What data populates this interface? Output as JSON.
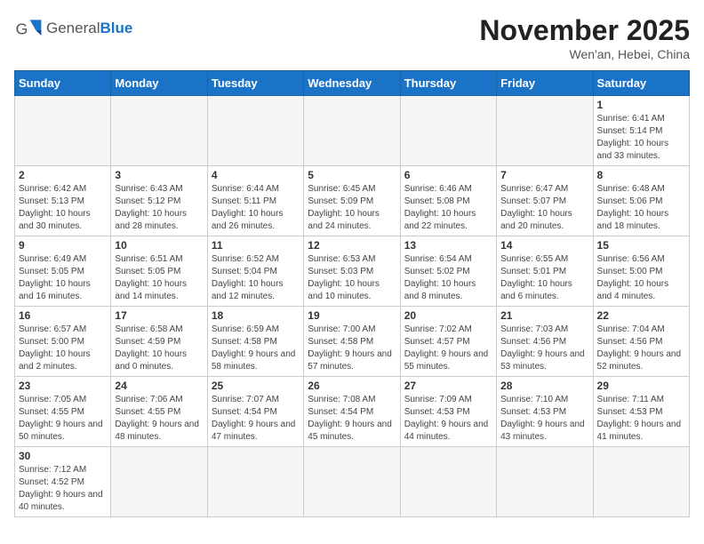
{
  "header": {
    "logo_general": "General",
    "logo_blue": "Blue",
    "month_title": "November 2025",
    "subtitle": "Wen'an, Hebei, China"
  },
  "weekdays": [
    "Sunday",
    "Monday",
    "Tuesday",
    "Wednesday",
    "Thursday",
    "Friday",
    "Saturday"
  ],
  "weeks": [
    [
      {
        "day": "",
        "info": ""
      },
      {
        "day": "",
        "info": ""
      },
      {
        "day": "",
        "info": ""
      },
      {
        "day": "",
        "info": ""
      },
      {
        "day": "",
        "info": ""
      },
      {
        "day": "",
        "info": ""
      },
      {
        "day": "1",
        "info": "Sunrise: 6:41 AM\nSunset: 5:14 PM\nDaylight: 10 hours and 33 minutes."
      }
    ],
    [
      {
        "day": "2",
        "info": "Sunrise: 6:42 AM\nSunset: 5:13 PM\nDaylight: 10 hours and 30 minutes."
      },
      {
        "day": "3",
        "info": "Sunrise: 6:43 AM\nSunset: 5:12 PM\nDaylight: 10 hours and 28 minutes."
      },
      {
        "day": "4",
        "info": "Sunrise: 6:44 AM\nSunset: 5:11 PM\nDaylight: 10 hours and 26 minutes."
      },
      {
        "day": "5",
        "info": "Sunrise: 6:45 AM\nSunset: 5:09 PM\nDaylight: 10 hours and 24 minutes."
      },
      {
        "day": "6",
        "info": "Sunrise: 6:46 AM\nSunset: 5:08 PM\nDaylight: 10 hours and 22 minutes."
      },
      {
        "day": "7",
        "info": "Sunrise: 6:47 AM\nSunset: 5:07 PM\nDaylight: 10 hours and 20 minutes."
      },
      {
        "day": "8",
        "info": "Sunrise: 6:48 AM\nSunset: 5:06 PM\nDaylight: 10 hours and 18 minutes."
      }
    ],
    [
      {
        "day": "9",
        "info": "Sunrise: 6:49 AM\nSunset: 5:05 PM\nDaylight: 10 hours and 16 minutes."
      },
      {
        "day": "10",
        "info": "Sunrise: 6:51 AM\nSunset: 5:05 PM\nDaylight: 10 hours and 14 minutes."
      },
      {
        "day": "11",
        "info": "Sunrise: 6:52 AM\nSunset: 5:04 PM\nDaylight: 10 hours and 12 minutes."
      },
      {
        "day": "12",
        "info": "Sunrise: 6:53 AM\nSunset: 5:03 PM\nDaylight: 10 hours and 10 minutes."
      },
      {
        "day": "13",
        "info": "Sunrise: 6:54 AM\nSunset: 5:02 PM\nDaylight: 10 hours and 8 minutes."
      },
      {
        "day": "14",
        "info": "Sunrise: 6:55 AM\nSunset: 5:01 PM\nDaylight: 10 hours and 6 minutes."
      },
      {
        "day": "15",
        "info": "Sunrise: 6:56 AM\nSunset: 5:00 PM\nDaylight: 10 hours and 4 minutes."
      }
    ],
    [
      {
        "day": "16",
        "info": "Sunrise: 6:57 AM\nSunset: 5:00 PM\nDaylight: 10 hours and 2 minutes."
      },
      {
        "day": "17",
        "info": "Sunrise: 6:58 AM\nSunset: 4:59 PM\nDaylight: 10 hours and 0 minutes."
      },
      {
        "day": "18",
        "info": "Sunrise: 6:59 AM\nSunset: 4:58 PM\nDaylight: 9 hours and 58 minutes."
      },
      {
        "day": "19",
        "info": "Sunrise: 7:00 AM\nSunset: 4:58 PM\nDaylight: 9 hours and 57 minutes."
      },
      {
        "day": "20",
        "info": "Sunrise: 7:02 AM\nSunset: 4:57 PM\nDaylight: 9 hours and 55 minutes."
      },
      {
        "day": "21",
        "info": "Sunrise: 7:03 AM\nSunset: 4:56 PM\nDaylight: 9 hours and 53 minutes."
      },
      {
        "day": "22",
        "info": "Sunrise: 7:04 AM\nSunset: 4:56 PM\nDaylight: 9 hours and 52 minutes."
      }
    ],
    [
      {
        "day": "23",
        "info": "Sunrise: 7:05 AM\nSunset: 4:55 PM\nDaylight: 9 hours and 50 minutes."
      },
      {
        "day": "24",
        "info": "Sunrise: 7:06 AM\nSunset: 4:55 PM\nDaylight: 9 hours and 48 minutes."
      },
      {
        "day": "25",
        "info": "Sunrise: 7:07 AM\nSunset: 4:54 PM\nDaylight: 9 hours and 47 minutes."
      },
      {
        "day": "26",
        "info": "Sunrise: 7:08 AM\nSunset: 4:54 PM\nDaylight: 9 hours and 45 minutes."
      },
      {
        "day": "27",
        "info": "Sunrise: 7:09 AM\nSunset: 4:53 PM\nDaylight: 9 hours and 44 minutes."
      },
      {
        "day": "28",
        "info": "Sunrise: 7:10 AM\nSunset: 4:53 PM\nDaylight: 9 hours and 43 minutes."
      },
      {
        "day": "29",
        "info": "Sunrise: 7:11 AM\nSunset: 4:53 PM\nDaylight: 9 hours and 41 minutes."
      }
    ],
    [
      {
        "day": "30",
        "info": "Sunrise: 7:12 AM\nSunset: 4:52 PM\nDaylight: 9 hours and 40 minutes."
      },
      {
        "day": "",
        "info": ""
      },
      {
        "day": "",
        "info": ""
      },
      {
        "day": "",
        "info": ""
      },
      {
        "day": "",
        "info": ""
      },
      {
        "day": "",
        "info": ""
      },
      {
        "day": "",
        "info": ""
      }
    ]
  ]
}
